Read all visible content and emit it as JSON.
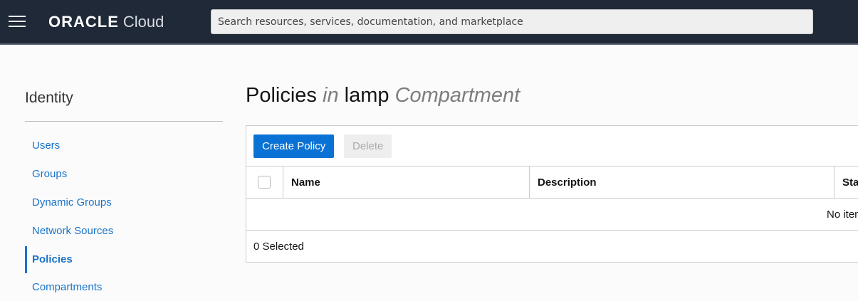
{
  "header": {
    "logo_brand": "ORACLE",
    "logo_product": "Cloud",
    "search_placeholder": "Search resources, services, documentation, and marketplace"
  },
  "sidebar": {
    "title": "Identity",
    "items": [
      {
        "label": "Users"
      },
      {
        "label": "Groups"
      },
      {
        "label": "Dynamic Groups"
      },
      {
        "label": "Network Sources"
      },
      {
        "label": "Policies",
        "active": true
      },
      {
        "label": "Compartments"
      }
    ]
  },
  "main": {
    "title_prefix": "Policies",
    "title_in": "in",
    "compartment": "lamp",
    "title_suffix": "Compartment",
    "buttons": {
      "create": "Create Policy",
      "delete": "Delete"
    },
    "table": {
      "columns": [
        "Name",
        "Description",
        "Status"
      ],
      "empty_text": "No items",
      "selected_count": "0 Selected"
    }
  },
  "colors": {
    "accent": "#0a72d4",
    "header_bg": "#1f2937"
  }
}
